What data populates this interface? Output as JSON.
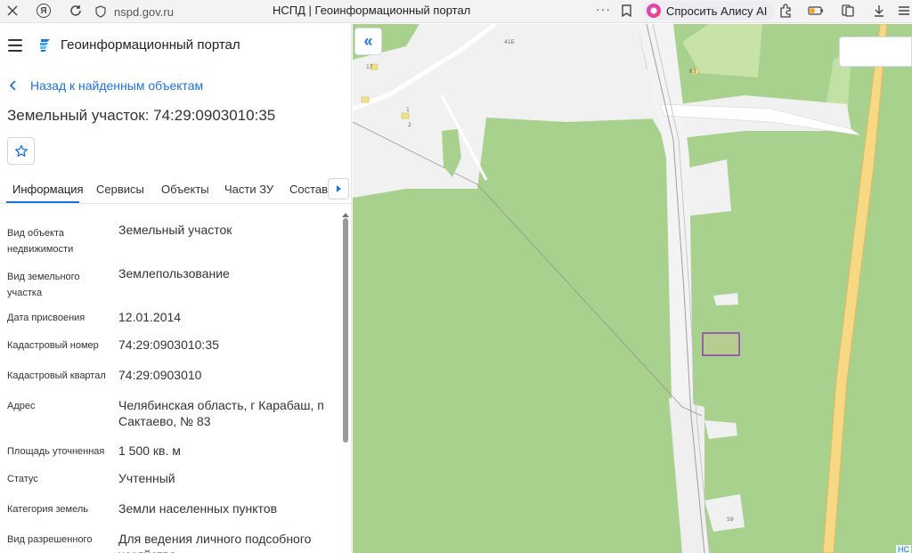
{
  "browser": {
    "url": "nspd.gov.ru",
    "tab_title": "НСПД | Геоинформационный портал",
    "more_dots": "···",
    "alice_label": "Спросить Алису AI",
    "yandex_glyph": "Я"
  },
  "app": {
    "title": "Геоинформационный портал",
    "back_label": "Назад к найденным объектам",
    "object_title": "Земельный участок: 74:29:0903010:35"
  },
  "tabs": [
    {
      "label": "Информация",
      "active": true
    },
    {
      "label": "Сервисы"
    },
    {
      "label": "Объекты"
    },
    {
      "label": "Части ЗУ"
    },
    {
      "label": "Состав"
    }
  ],
  "properties": [
    {
      "label": "Вид объекта недвижимости",
      "value": "Земельный участок"
    },
    {
      "label": "Вид земельного участка",
      "value": "Землепользование"
    },
    {
      "label": "Дата присвоения",
      "value": "12.01.2014"
    },
    {
      "label": "Кадастровый номер",
      "value": "74:29:0903010:35"
    },
    {
      "label": "Кадастровый квартал",
      "value": "74:29:0903010"
    },
    {
      "label": "Адрес",
      "value": "Челябинская область, г Карабаш, п Сактаево, № 83"
    },
    {
      "label": "Площадь уточненная",
      "value": "1 500 кв. м"
    },
    {
      "label": "Статус",
      "value": "Учтенный"
    },
    {
      "label": "Категория земель",
      "value": "Земли населенных пунктов"
    },
    {
      "label": "Вид разрешенного",
      "value": "Для ведения личного подсобного хозяйства"
    }
  ],
  "map": {
    "collapse_glyph": "«",
    "corner_label": "НС",
    "parcel_color": "#8e3fb4",
    "labels": {
      "l1": "41Б",
      "l2": "17",
      "l3": "83",
      "l4": "1",
      "l5": "2",
      "l6": "59"
    }
  },
  "colors": {
    "accent": "#1a73e8",
    "forest": "#a9d18e",
    "road": "#f7d884"
  }
}
